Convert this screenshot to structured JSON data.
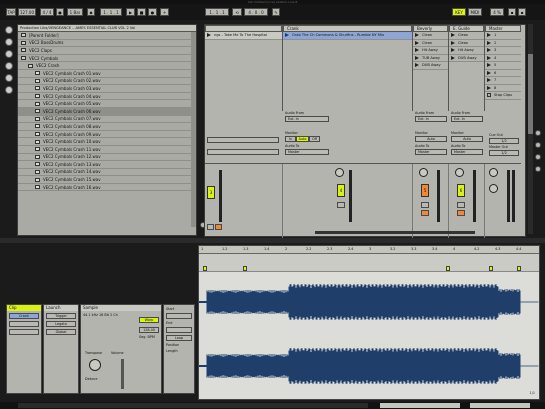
{
  "window_title": "Set Untitled  [Live] Ableton Live 8",
  "transport": {
    "tap": "TAP",
    "tempo": "127.00",
    "meter": "4 / 4",
    "quantize": "1 Bar",
    "position": "1 . 1 . 1",
    "loop_start": "1 . 1 . 1",
    "loop_len": "4 . 0 . 0",
    "key": "KEY",
    "midi": "MIDI",
    "cpu": "4 %"
  },
  "browser": {
    "path": "Production Libs/VENGEANCE ...AMES ESSENTIAL CLUB VOL 2 Vol",
    "items": [
      {
        "label": "[Parent Folder]",
        "depth": 0,
        "type": "folder",
        "selected": false
      },
      {
        "label": "VEC2 BassDrums",
        "depth": 0,
        "type": "folder",
        "selected": false
      },
      {
        "label": "VEC2 Claps",
        "depth": 0,
        "type": "folder",
        "selected": false
      },
      {
        "label": "VEC2 Cymbals",
        "depth": 0,
        "type": "folder",
        "selected": false
      },
      {
        "label": "VEC2 Crash",
        "depth": 1,
        "type": "folder",
        "selected": false
      },
      {
        "label": "VEC2 Cymbals Crash 01.wav",
        "depth": 2,
        "type": "file",
        "selected": false
      },
      {
        "label": "VEC2 Cymbals Crash 02.wav",
        "depth": 2,
        "type": "file",
        "selected": false
      },
      {
        "label": "VEC2 Cymbals Crash 03.wav",
        "depth": 2,
        "type": "file",
        "selected": false
      },
      {
        "label": "VEC2 Cymbals Crash 04.wav",
        "depth": 2,
        "type": "file",
        "selected": false
      },
      {
        "label": "VEC2 Cymbals Crash 05.wav",
        "depth": 2,
        "type": "file",
        "selected": false
      },
      {
        "label": "VEC2 Cymbals Crash 06.wav",
        "depth": 2,
        "type": "file",
        "selected": true
      },
      {
        "label": "VEC2 Cymbals Crash 07.wav",
        "depth": 2,
        "type": "file",
        "selected": false
      },
      {
        "label": "VEC2 Cymbals Crash 08.wav",
        "depth": 2,
        "type": "file",
        "selected": false
      },
      {
        "label": "VEC2 Cymbals Crash 09.wav",
        "depth": 2,
        "type": "file",
        "selected": false
      },
      {
        "label": "VEC2 Cymbals Crash 10.wav",
        "depth": 2,
        "type": "file",
        "selected": false
      },
      {
        "label": "VEC2 Cymbals Crash 11.wav",
        "depth": 2,
        "type": "file",
        "selected": false
      },
      {
        "label": "VEC2 Cymbals Crash 12.wav",
        "depth": 2,
        "type": "file",
        "selected": false
      },
      {
        "label": "VEC2 Cymbals Crash 13.wav",
        "depth": 2,
        "type": "file",
        "selected": false
      },
      {
        "label": "VEC2 Cymbals Crash 14.wav",
        "depth": 2,
        "type": "file",
        "selected": false
      },
      {
        "label": "VEC2 Cymbals Crash 15.wav",
        "depth": 2,
        "type": "file",
        "selected": false
      },
      {
        "label": "VEC2 Cymbals Crash 16.wav",
        "depth": 2,
        "type": "file",
        "selected": false
      }
    ]
  },
  "session": {
    "tracks": [
      {
        "name": "",
        "clip": "ngs - Take Me To The Hospital",
        "color": "#c8c9c1"
      },
      {
        "name": "Crank",
        "clip": "Grab The Ch Commons & Shurfins - Rumble NY Mix",
        "color": "#8da6d6"
      },
      {
        "name": "Beverly",
        "clips": [
          "Clean",
          "Clean",
          "Hit Away",
          "TUB Away",
          "DUB Away"
        ],
        "color": "#c8c9c1"
      },
      {
        "name": "E. Guide",
        "clips": [
          "Clean",
          "Clean",
          "Hit Away",
          "DUB Away"
        ],
        "color": "#c8c9c1"
      },
      {
        "name": "Master",
        "scenes": [
          "1",
          "2",
          "3",
          "4",
          "5",
          "6",
          "7",
          "8"
        ],
        "color": "#c8c9c1"
      }
    ],
    "stop_clips": "Stop Clips",
    "io": {
      "audio_from": "Audio From",
      "ext_in": "Ext. In",
      "monitor": "Monitor",
      "in": "In",
      "auto": "Auto",
      "off": "Off",
      "audio_to": "Audio To",
      "master": "Master",
      "cue_out": "Cue Out",
      "master_out": "Master Out",
      "cue_val": "1/2",
      "master_val": "1/2"
    },
    "track_numbers": [
      "3",
      "4",
      "5",
      "6"
    ]
  },
  "clip_view": {
    "clip_label": "Clip",
    "clip_name": "Crank",
    "launch_label": "Launch",
    "launch_mode": "Trigger",
    "legato": "Legato",
    "quant": "Global",
    "sample_label": "Sample",
    "sample_info": "44.1 kHz 16 Bit 2 Ch",
    "warp": "Warp",
    "bpm": "128.00",
    "seg_bpm": "Seg. BPM",
    "start": "Start",
    "end": "End",
    "loop": "Loop",
    "position": "Position",
    "length": "Length",
    "volume": "Volume",
    "transpose": "Transpose",
    "detune": "Detune",
    "page": "1/1"
  },
  "arrangement": {
    "ruler": [
      "1",
      "1.2",
      "1.3",
      "1.4",
      "2",
      "2.2",
      "2.3",
      "2.4",
      "3",
      "3.2",
      "3.3",
      "3.4",
      "4",
      "4.2",
      "4.3",
      "4.4"
    ],
    "waveform_color": "#1f3f6a",
    "bg_color": "#dcdcd8"
  },
  "colors": {
    "accent_yellow": "#d8f218",
    "accent_orange": "#f0883a",
    "accent_green": "#a8d65a",
    "chrome": "#1b1b1b"
  }
}
